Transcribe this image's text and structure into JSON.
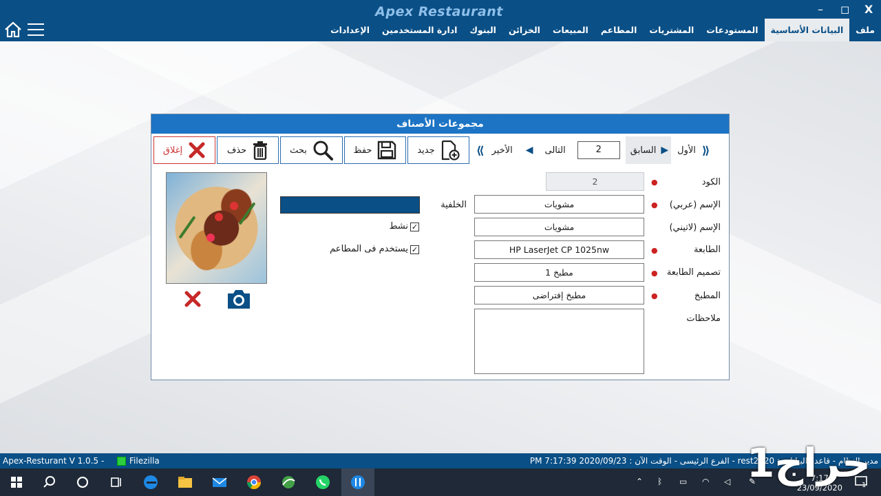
{
  "window": {
    "title": "Apex Restaurant",
    "minimize": "–",
    "maximize": "◻",
    "close": "X"
  },
  "menu": [
    {
      "label": "ملف",
      "active": false
    },
    {
      "label": "البيانات الأساسية",
      "active": true
    },
    {
      "label": "المستودعات",
      "active": false
    },
    {
      "label": "المشتريات",
      "active": false
    },
    {
      "label": "المطاعم",
      "active": false
    },
    {
      "label": "المبيعات",
      "active": false
    },
    {
      "label": "الخزائن",
      "active": false
    },
    {
      "label": "البنوك",
      "active": false
    },
    {
      "label": "ادارة المستخدمين",
      "active": false
    },
    {
      "label": "الإعدادات",
      "active": false
    }
  ],
  "form": {
    "title": "مجموعات الأصناف",
    "nav": {
      "first": "الأول",
      "previous": "السابق",
      "record": "2",
      "next": "التالى",
      "last": "الأخير"
    },
    "toolbar": {
      "new": "جديد",
      "save": "حفظ",
      "search": "بحث",
      "delete": "حذف",
      "close": "إغلاق"
    },
    "fields": {
      "code_label": "الكود",
      "code_value": "2",
      "name_ar_label": "الإسم (عربي)",
      "name_ar_value": "مشويات",
      "name_en_label": "الإسم (لاتيني)",
      "name_en_value": "مشويات",
      "printer_label": "الطابعة",
      "printer_value": "HP LaserJet CP 1025nw",
      "print_design_label": "تصميم الطابعة",
      "print_design_value": "مطبخ 1",
      "kitchen_label": "المطبخ",
      "kitchen_value": "مطبخ إفتراضى",
      "notes_label": "ملاحظات",
      "notes_value": "",
      "background_label": "الخلفية",
      "background_color": "#0a4f86",
      "active_label": "نشط",
      "active_checked": true,
      "use_in_restaurants_label": "يستخدم فى المطاعم",
      "use_in_restaurants_checked": true
    }
  },
  "statusbar": {
    "version": "Apex-Resturant V 1.0.5  -",
    "filezilla": "Filezilla",
    "info": "مدير النظام - قاعدة البيانات : rest2020  -  الفرع الرئيسى  -  الوقت الآن : 2020/09/23  PM 7:17:39"
  },
  "taskbar": {
    "time": "7:17",
    "date": "23/09/2020",
    "notifications": "1"
  },
  "watermark": "حراج1",
  "colors": {
    "primary": "#0a4f86",
    "header": "#1d74c4",
    "required": "#cc2222"
  }
}
